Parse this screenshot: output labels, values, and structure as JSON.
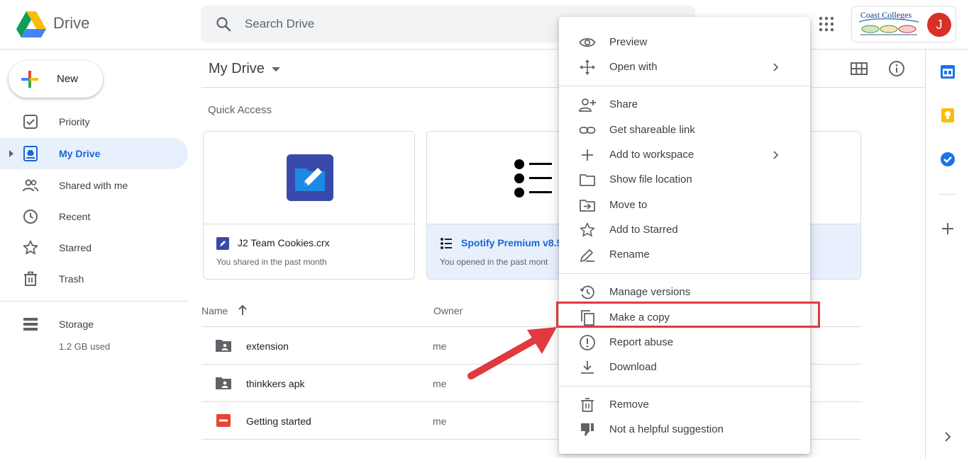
{
  "header": {
    "app_name": "Drive",
    "search_placeholder": "Search Drive",
    "org_name": "Coast Colleges",
    "avatar_initial": "J"
  },
  "sidebar": {
    "new_label": "New",
    "items": [
      {
        "label": "Priority",
        "icon": "priority-icon"
      },
      {
        "label": "My Drive",
        "icon": "my-drive-icon",
        "active": true
      },
      {
        "label": "Shared with me",
        "icon": "shared-icon"
      },
      {
        "label": "Recent",
        "icon": "clock-icon"
      },
      {
        "label": "Starred",
        "icon": "star-icon"
      },
      {
        "label": "Trash",
        "icon": "trash-icon"
      }
    ],
    "storage": {
      "label": "Storage",
      "used": "1.2 GB used"
    }
  },
  "main": {
    "title": "My Drive",
    "quick_access_title": "Quick Access",
    "cards": [
      {
        "name": "J2 Team Cookies.crx",
        "subtitle": "You shared in the past month"
      },
      {
        "name": "Spotify Premium v8.5",
        "subtitle": "You opened in the past mont"
      }
    ],
    "columns": {
      "name": "Name",
      "owner": "Owner"
    },
    "files": [
      {
        "name": "extension",
        "owner": "me",
        "type": "shared-folder"
      },
      {
        "name": "thinkkers apk",
        "owner": "me",
        "type": "shared-folder"
      },
      {
        "name": "Getting started",
        "owner": "me",
        "type": "pdf"
      }
    ]
  },
  "context_menu": {
    "groups": [
      [
        {
          "label": "Preview",
          "icon": "eye-icon"
        },
        {
          "label": "Open with",
          "icon": "move-arrows-icon",
          "submenu": true
        }
      ],
      [
        {
          "label": "Share",
          "icon": "person-add-icon"
        },
        {
          "label": "Get shareable link",
          "icon": "link-icon"
        },
        {
          "label": "Add to workspace",
          "icon": "plus-icon",
          "submenu": true
        },
        {
          "label": "Show file location",
          "icon": "folder-icon"
        },
        {
          "label": "Move to",
          "icon": "move-to-icon"
        },
        {
          "label": "Add to Starred",
          "icon": "star-outline-icon"
        },
        {
          "label": "Rename",
          "icon": "pencil-icon"
        }
      ],
      [
        {
          "label": "Manage versions",
          "icon": "history-icon"
        },
        {
          "label": "Make a copy",
          "icon": "copy-icon",
          "highlighted": true
        },
        {
          "label": "Report abuse",
          "icon": "alert-icon"
        },
        {
          "label": "Download",
          "icon": "download-icon"
        }
      ],
      [
        {
          "label": "Remove",
          "icon": "trash-icon"
        },
        {
          "label": "Not a helpful suggestion",
          "icon": "thumb-down-icon"
        }
      ]
    ]
  },
  "colors": {
    "accent": "#1967d2",
    "active_bg": "#e8f0fe",
    "highlight": "#e0393e"
  }
}
